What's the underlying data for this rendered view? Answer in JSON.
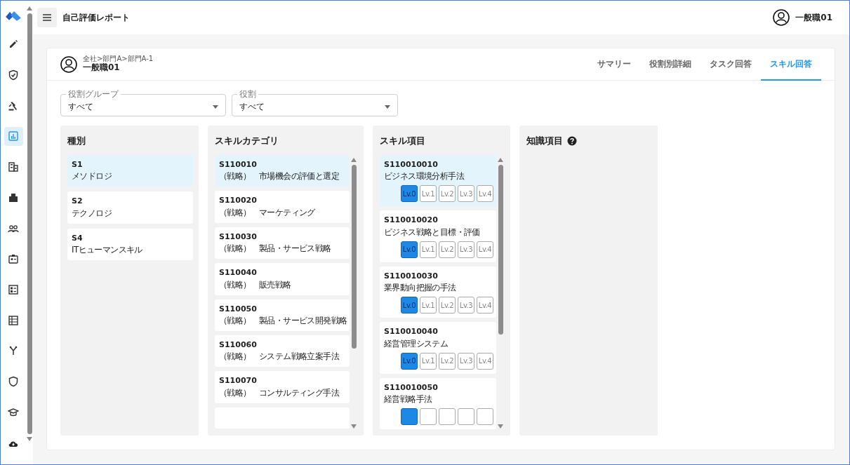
{
  "header": {
    "title": "自己評価レポート",
    "user": "一般職01"
  },
  "sidebar": {
    "items": [
      {
        "kind": "pencil",
        "selected": false
      },
      {
        "kind": "shield-check",
        "selected": false
      },
      {
        "kind": "gavel",
        "selected": false
      },
      {
        "kind": "chart",
        "selected": true
      },
      {
        "kind": "building",
        "selected": false
      },
      {
        "kind": "buildings",
        "selected": false
      },
      {
        "kind": "people",
        "selected": false
      },
      {
        "kind": "badge",
        "selected": false
      },
      {
        "kind": "list",
        "selected": false
      },
      {
        "kind": "table",
        "selected": false
      },
      {
        "kind": "fork",
        "selected": false
      },
      {
        "kind": "shield",
        "selected": false
      },
      {
        "kind": "cap",
        "selected": false
      },
      {
        "kind": "cloud",
        "selected": false
      }
    ]
  },
  "profile": {
    "path": "全社>部門A>部門A-1",
    "name": "一般職01"
  },
  "tabs": [
    {
      "label": "サマリー",
      "selected": false
    },
    {
      "label": "役割別詳細",
      "selected": false
    },
    {
      "label": "タスク回答",
      "selected": false
    },
    {
      "label": "スキル回答",
      "selected": true
    }
  ],
  "filters": [
    {
      "label": "役割グループ",
      "value": "すべて"
    },
    {
      "label": "役割",
      "value": "すべて"
    }
  ],
  "types": {
    "title": "種別",
    "items": [
      {
        "code": "S1",
        "name": "メソドロジ",
        "selected": true
      },
      {
        "code": "S2",
        "name": "テクノロジ",
        "selected": false
      },
      {
        "code": "S4",
        "name": "ITヒューマンスキル",
        "selected": false
      }
    ]
  },
  "categories": {
    "title": "スキルカテゴリ",
    "items": [
      {
        "code": "S110010",
        "name": "（戦略）　市場機会の評価と選定",
        "selected": true
      },
      {
        "code": "S110020",
        "name": "（戦略）　マーケティング",
        "selected": false
      },
      {
        "code": "S110030",
        "name": "（戦略）　製品・サービス戦略",
        "selected": false
      },
      {
        "code": "S110040",
        "name": "（戦略）　販売戦略",
        "selected": false
      },
      {
        "code": "S110050",
        "name": "（戦略）　製品・サービス開発戦略",
        "selected": false
      },
      {
        "code": "S110060",
        "name": "（戦略）　システム戦略立案手法",
        "selected": false
      },
      {
        "code": "S110070",
        "name": "（戦略）　コンサルティング手法",
        "selected": false
      },
      {
        "selected": false
      }
    ]
  },
  "skills": {
    "title": "スキル項目",
    "items": [
      {
        "code": "S110010010",
        "name": "ビジネス環境分析手法",
        "selected": true,
        "levels": [
          {
            "label": "Lv.0",
            "selected": true
          },
          {
            "label": "Lv.1",
            "selected": false
          },
          {
            "label": "Lv.2",
            "selected": false
          },
          {
            "label": "Lv.3",
            "selected": false
          },
          {
            "label": "Lv.4",
            "selected": false
          }
        ]
      },
      {
        "code": "S110010020",
        "name": "ビジネス戦略と目標・評価",
        "selected": false,
        "levels": [
          {
            "label": "Lv.0",
            "selected": true
          },
          {
            "label": "Lv.1",
            "selected": false
          },
          {
            "label": "Lv.2",
            "selected": false
          },
          {
            "label": "Lv.3",
            "selected": false
          },
          {
            "label": "Lv.4",
            "selected": false
          }
        ]
      },
      {
        "code": "S110010030",
        "name": "業界動向把握の手法",
        "selected": false,
        "levels": [
          {
            "label": "Lv.0",
            "selected": true
          },
          {
            "label": "Lv.1",
            "selected": false
          },
          {
            "label": "Lv.2",
            "selected": false
          },
          {
            "label": "Lv.3",
            "selected": false
          },
          {
            "label": "Lv.4",
            "selected": false
          }
        ]
      },
      {
        "code": "S110010040",
        "name": "経営管理システム",
        "selected": false,
        "levels": [
          {
            "label": "Lv.0",
            "selected": true
          },
          {
            "label": "Lv.1",
            "selected": false
          },
          {
            "label": "Lv.2",
            "selected": false
          },
          {
            "label": "Lv.3",
            "selected": false
          },
          {
            "label": "Lv.4",
            "selected": false
          }
        ]
      },
      {
        "code": "S110010050",
        "name": "経営戦略手法",
        "selected": false,
        "levels": [
          {
            "selected": true
          },
          {
            "selected": false
          },
          {
            "selected": false
          },
          {
            "selected": false
          },
          {
            "selected": false
          }
        ]
      }
    ]
  },
  "knowledge": {
    "title": "知識項目"
  }
}
